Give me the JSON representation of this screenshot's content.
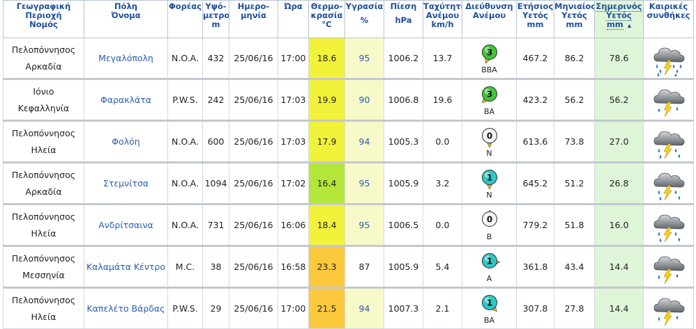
{
  "columns": [
    {
      "key": "region",
      "lines": [
        "Γεωγραφική",
        "Περιοχή",
        "Νομός"
      ]
    },
    {
      "key": "city",
      "lines": [
        "Πόλη",
        "Όνομα"
      ]
    },
    {
      "key": "source",
      "lines": [
        "Φορέας"
      ]
    },
    {
      "key": "altitude",
      "lines": [
        "Υψό-",
        "μετρο",
        "m"
      ]
    },
    {
      "key": "date",
      "lines": [
        "Ημερο-",
        "μηνία"
      ]
    },
    {
      "key": "time",
      "lines": [
        "Ώρα"
      ]
    },
    {
      "key": "temp",
      "lines": [
        "Θερμο-",
        "κρασία",
        "°C"
      ]
    },
    {
      "key": "humidity",
      "lines": [
        "Υγρασία",
        "%"
      ]
    },
    {
      "key": "pressure",
      "lines": [
        "Πίεση",
        "hPa"
      ]
    },
    {
      "key": "wind_speed",
      "lines": [
        "Ταχύτητα",
        "Ανέμου",
        "km/h"
      ]
    },
    {
      "key": "wind_dir",
      "lines": [
        "Διεύθυνση",
        "Ανέμου"
      ]
    },
    {
      "key": "rain_year",
      "lines": [
        "Ετήσιος",
        "Υετός",
        "mm"
      ]
    },
    {
      "key": "rain_month",
      "lines": [
        "Μηνιαίος",
        "Υετός",
        "mm"
      ]
    },
    {
      "key": "rain_today",
      "lines": [
        "Σημερινός",
        "Υετός",
        "mm"
      ],
      "sorted": true,
      "sort_indicator": "▲"
    },
    {
      "key": "conditions",
      "lines": [
        "Καιρικές",
        "συνθήκες"
      ]
    }
  ],
  "rows": [
    {
      "region": "Πελοπόννησος",
      "prefecture": "Αρκαδία",
      "city": "Μεγαλόπολη",
      "source": "N.O.A.",
      "altitude": "432",
      "date": "25/06/16",
      "time": "17:00",
      "temp": "18.6",
      "humidity": "95",
      "pressure": "1006.2",
      "wind_speed": "13.7",
      "wind_beaufort": "3",
      "wind_dir": "ΒΒΑ",
      "wind_angle": 22,
      "rain_year": "467.2",
      "rain_month": "86.2",
      "rain_today": "78.6",
      "conditions_icon": "heavy-rain-thunder-icon"
    },
    {
      "region": "Ιόνιο",
      "prefecture": "Κεφαλληνία",
      "city": "Φαρακλάτα",
      "source": "P.W.S.",
      "altitude": "242",
      "date": "25/06/16",
      "time": "17:03",
      "temp": "19.9",
      "humidity": "90",
      "pressure": "1006.8",
      "wind_speed": "19.6",
      "wind_beaufort": "3",
      "wind_dir": "ΒΑ",
      "wind_angle": 45,
      "rain_year": "423.2",
      "rain_month": "56.2",
      "rain_today": "56.2",
      "conditions_icon": "thunderstorm-icon"
    },
    {
      "region": "Πελοπόννησος",
      "prefecture": "Ηλεία",
      "city": "Φολόη",
      "source": "N.O.A.",
      "altitude": "600",
      "date": "25/06/16",
      "time": "17:03",
      "temp": "17.9",
      "humidity": "94",
      "pressure": "1005.3",
      "wind_speed": "0.0",
      "wind_beaufort": "0",
      "wind_dir": "N",
      "wind_angle": 0,
      "rain_year": "613.6",
      "rain_month": "73.8",
      "rain_today": "27.0",
      "conditions_icon": "rain-thunder-icon"
    },
    {
      "region": "Πελοπόννησος",
      "prefecture": "Αρκαδία",
      "city": "Στεμνίτσα",
      "source": "N.O.A.",
      "altitude": "1094",
      "date": "25/06/16",
      "time": "17:02",
      "temp": "16.4",
      "humidity": "95",
      "pressure": "1005.9",
      "wind_speed": "3.2",
      "wind_beaufort": "1",
      "wind_dir": "N",
      "wind_angle": 0,
      "rain_year": "645.2",
      "rain_month": "51.2",
      "rain_today": "26.8",
      "conditions_icon": "rain-thunder-icon"
    },
    {
      "region": "Πελοπόννησος",
      "prefecture": "Ηλεία",
      "city": "Ανδρίτσαινα",
      "source": "N.O.A.",
      "altitude": "731",
      "date": "25/06/16",
      "time": "16:06",
      "temp": "18.4",
      "humidity": "95",
      "pressure": "1006.5",
      "wind_speed": "0.0",
      "wind_beaufort": "0",
      "wind_dir": "Β",
      "wind_angle": 180,
      "rain_year": "779.2",
      "rain_month": "51.8",
      "rain_today": "16.0",
      "conditions_icon": "rain-thunder-icon"
    },
    {
      "region": "Πελοπόννησος",
      "prefecture": "Μεσσηνία",
      "city": "Καλαμάτα Κέντρο",
      "source": "M.C.",
      "altitude": "38",
      "date": "25/06/16",
      "time": "16:58",
      "temp": "23.3",
      "humidity": "87",
      "pressure": "1005.9",
      "wind_speed": "5.4",
      "wind_beaufort": "1",
      "wind_dir": "Α",
      "wind_angle": 270,
      "rain_year": "361.8",
      "rain_month": "43.4",
      "rain_today": "14.4",
      "conditions_icon": "thunderstorm-icon"
    },
    {
      "region": "Πελοπόννησος",
      "prefecture": "Ηλεία",
      "city": "Καπελέτο Βάρδας",
      "source": "P.W.S.",
      "altitude": "29",
      "date": "25/06/16",
      "time": "17:00",
      "temp": "21.5",
      "humidity": "94",
      "pressure": "1007.3",
      "wind_speed": "2.1",
      "wind_beaufort": "1",
      "wind_dir": "ΒΑ",
      "wind_angle": 315,
      "rain_year": "307.8",
      "rain_month": "27.8",
      "rain_today": "14.4",
      "conditions_icon": "thunderstorm-icon"
    }
  ],
  "colors": {
    "header_text": "#1f4f99",
    "link": "#2a5db0",
    "temp_yellow": "#f2f23a",
    "temp_green": "#b3e639",
    "temp_orange": "#fcc93c",
    "humidity_high": "#f7f9c8",
    "today_bg": "#dff5d8",
    "wind_green": "#43c43a",
    "wind_cyan": "#2fc6c6",
    "wind_white": "#f4f4f4"
  }
}
